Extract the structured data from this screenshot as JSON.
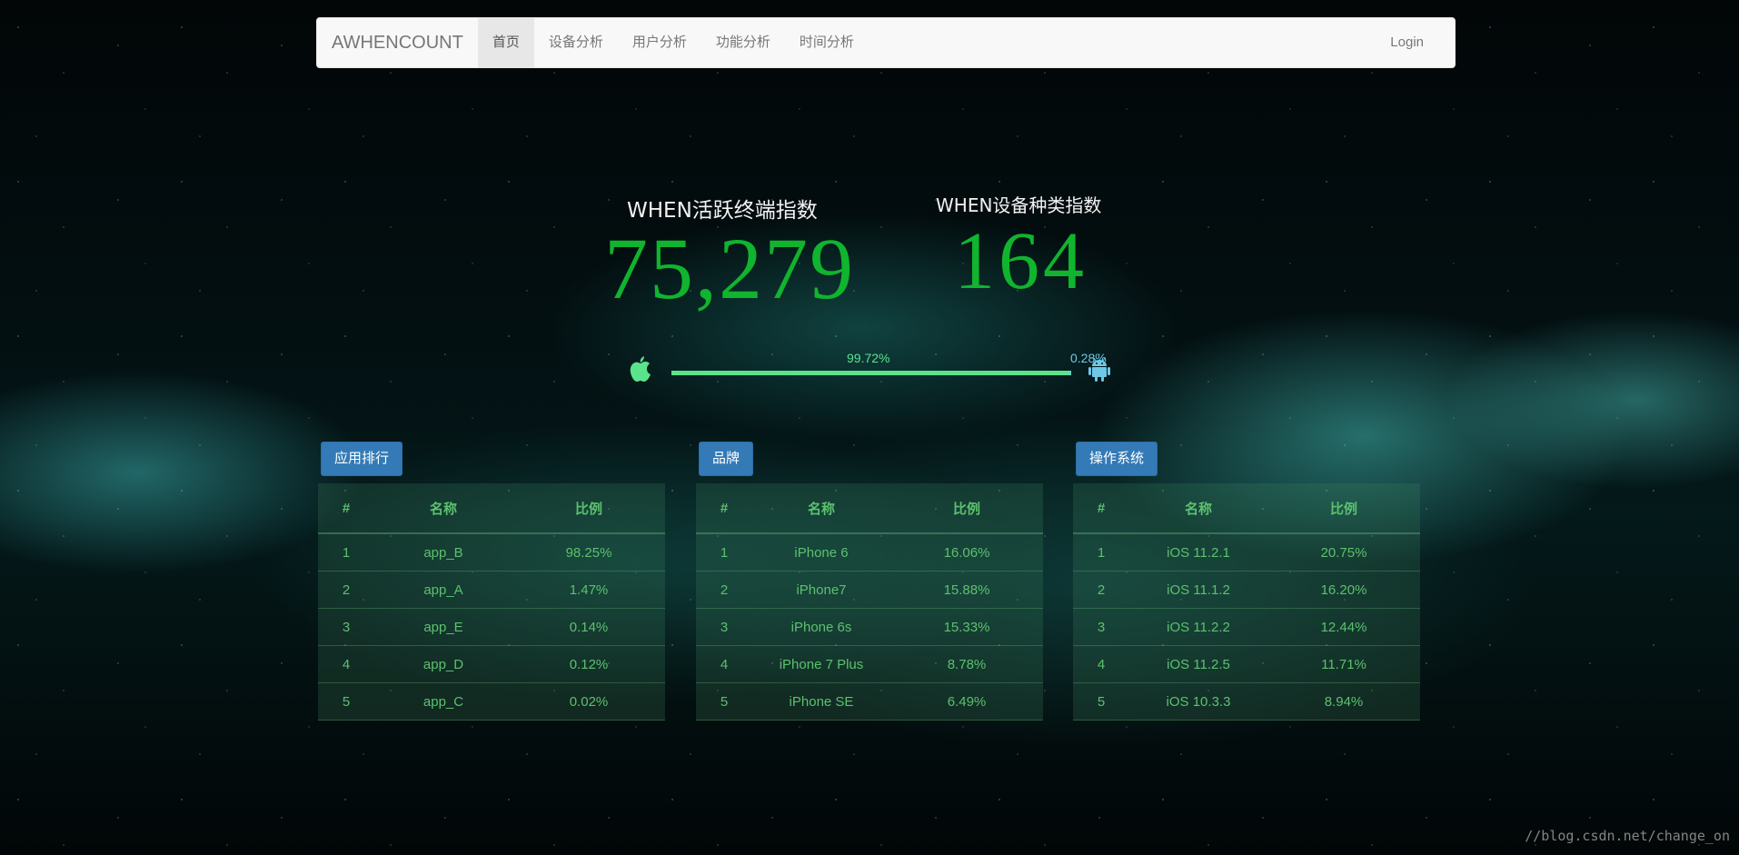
{
  "navbar": {
    "brand": "AWHENCOUNT",
    "items": [
      {
        "label": "首页",
        "active": true
      },
      {
        "label": "设备分析",
        "active": false
      },
      {
        "label": "用户分析",
        "active": false
      },
      {
        "label": "功能分析",
        "active": false
      },
      {
        "label": "时间分析",
        "active": false
      }
    ],
    "login": "Login"
  },
  "stats": {
    "active_terminals": {
      "label": "WHEN活跃终端指数",
      "value": "75,279"
    },
    "device_types": {
      "label": "WHEN设备种类指数",
      "value": "164"
    }
  },
  "platform_share": {
    "ios_label": "99.72%",
    "android_label": "0.28%",
    "ios_fraction": 0.9972,
    "ios_color": "#5be38c",
    "android_color": "#6ec8e8",
    "ios_icon": "apple-icon",
    "android_icon": "android-icon"
  },
  "tables": [
    {
      "title": "应用排行",
      "headers": [
        "#",
        "名称",
        "比例"
      ],
      "rows": [
        [
          "1",
          "app_B",
          "98.25%"
        ],
        [
          "2",
          "app_A",
          "1.47%"
        ],
        [
          "3",
          "app_E",
          "0.14%"
        ],
        [
          "4",
          "app_D",
          "0.12%"
        ],
        [
          "5",
          "app_C",
          "0.02%"
        ]
      ]
    },
    {
      "title": "品牌",
      "headers": [
        "#",
        "名称",
        "比例"
      ],
      "rows": [
        [
          "1",
          "iPhone 6",
          "16.06%"
        ],
        [
          "2",
          "iPhone7",
          "15.88%"
        ],
        [
          "3",
          "iPhone 6s",
          "15.33%"
        ],
        [
          "4",
          "iPhone 7 Plus",
          "8.78%"
        ],
        [
          "5",
          "iPhone SE",
          "6.49%"
        ]
      ]
    },
    {
      "title": "操作系统",
      "headers": [
        "#",
        "名称",
        "比例"
      ],
      "rows": [
        [
          "1",
          "iOS 11.2.1",
          "20.75%"
        ],
        [
          "2",
          "iOS 11.1.2",
          "16.20%"
        ],
        [
          "3",
          "iOS 11.2.2",
          "12.44%"
        ],
        [
          "4",
          "iOS 11.2.5",
          "11.71%"
        ],
        [
          "5",
          "iOS 10.3.3",
          "8.94%"
        ]
      ]
    }
  ],
  "watermark": "//blog.csdn.net/change_on"
}
